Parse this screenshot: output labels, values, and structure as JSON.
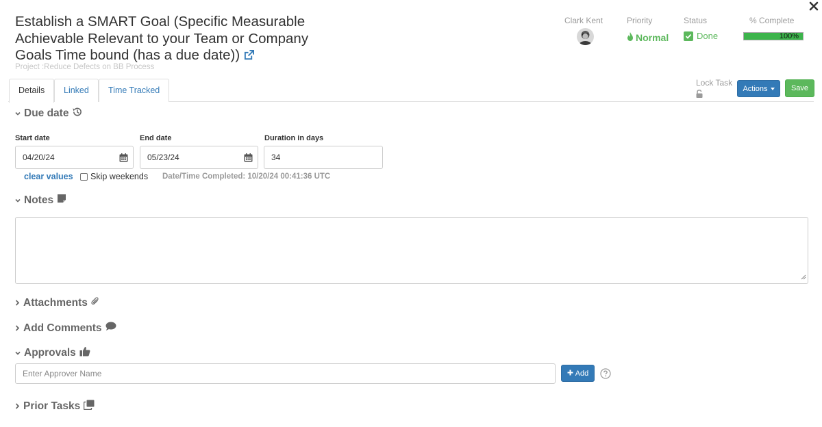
{
  "task": {
    "title": "Establish a SMART Goal (Specific Measurable Achievable Relevant to your Team or Company Goals Time bound (has a due date))",
    "project": "Project :Reduce Defects on BB Process"
  },
  "header": {
    "owner_label": "Clark Kent",
    "priority_label": "Priority",
    "priority_value": "Normal",
    "status_label": "Status",
    "status_value": "Done",
    "complete_label": "% Complete",
    "complete_value": "100%",
    "complete_fraction": 1.0
  },
  "tabs": [
    {
      "label": "Details",
      "active": true
    },
    {
      "label": "Linked",
      "active": false
    },
    {
      "label": "Time Tracked",
      "active": false
    }
  ],
  "toolbar": {
    "lock_label": "Lock Task",
    "actions_label": "Actions",
    "save_label": "Save"
  },
  "due_date": {
    "heading": "Due date",
    "start_label": "Start date",
    "start_value": "04/20/24",
    "end_label": "End date",
    "end_value": "05/23/24",
    "duration_label": "Duration in days",
    "duration_value": "34",
    "clear_label": "clear values",
    "skip_label": "Skip weekends",
    "completed_text": "Date/Time Completed: 10/20/24 00:41:36 UTC"
  },
  "sections": {
    "notes": "Notes",
    "attachments": "Attachments",
    "comments": "Add Comments",
    "approvals": "Approvals",
    "prior_tasks": "Prior Tasks"
  },
  "approvals": {
    "placeholder": "Enter Approver Name",
    "add_label": "Add"
  },
  "colors": {
    "primary": "#337ab7",
    "success": "#5cb85c",
    "progress": "#3cb44b"
  }
}
